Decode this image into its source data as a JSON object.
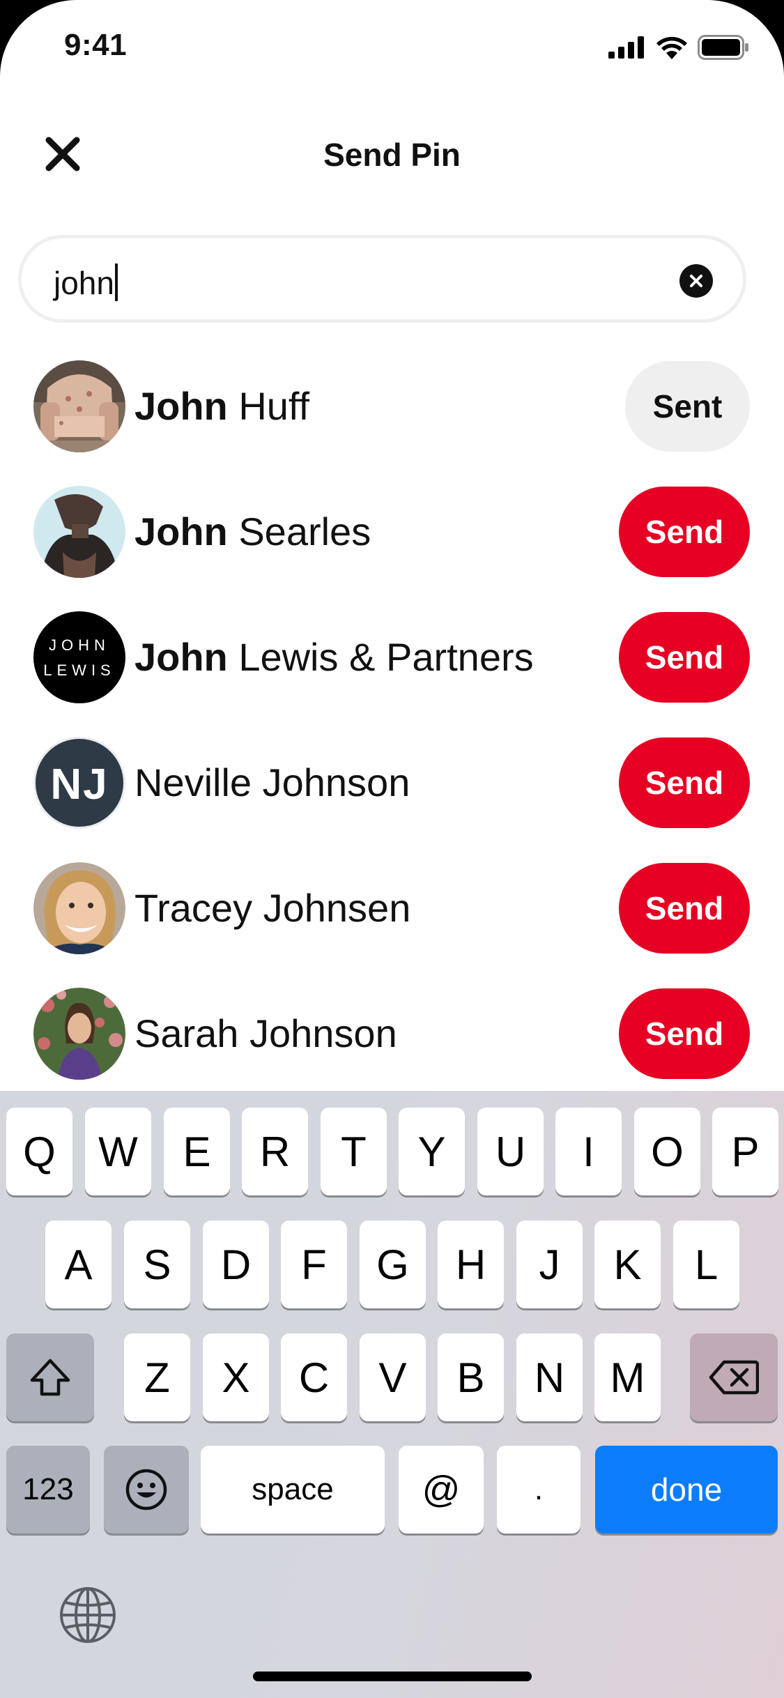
{
  "status_bar": {
    "time": "9:41"
  },
  "header": {
    "title": "Send Pin"
  },
  "search": {
    "value": "john"
  },
  "results": [
    {
      "bold": "John",
      "rest": " Huff",
      "action": "Sent"
    },
    {
      "bold": "John",
      "rest": " Searles",
      "action": "Send"
    },
    {
      "bold": "John",
      "rest": " Lewis & Partners",
      "action": "Send",
      "avatar_text_1": "JOHN",
      "avatar_text_2": "LEWIS"
    },
    {
      "bold": "",
      "rest": "Neville Johnson",
      "action": "Send",
      "avatar_initials": "NJ"
    },
    {
      "bold": "",
      "rest": "Tracey Johnsen",
      "action": "Send"
    },
    {
      "bold": "",
      "rest": "Sarah Johnson",
      "action": "Send"
    }
  ],
  "keyboard": {
    "row1": [
      "Q",
      "W",
      "E",
      "R",
      "T",
      "Y",
      "U",
      "I",
      "O",
      "P"
    ],
    "row2": [
      "A",
      "S",
      "D",
      "F",
      "G",
      "H",
      "J",
      "K",
      "L"
    ],
    "row3": [
      "Z",
      "X",
      "C",
      "V",
      "B",
      "N",
      "M"
    ],
    "numbers_label": "123",
    "space_label": "space",
    "at_label": "@",
    "dot_label": ".",
    "done_label": "done"
  },
  "colors": {
    "brand_red": "#e60023",
    "sent_gray": "#efefef",
    "done_blue": "#0b7dfb"
  },
  "icons": [
    "close-icon",
    "clear-icon",
    "signal-icon",
    "wifi-icon",
    "battery-icon",
    "shift-icon",
    "backspace-icon",
    "emoji-icon",
    "globe-icon"
  ]
}
